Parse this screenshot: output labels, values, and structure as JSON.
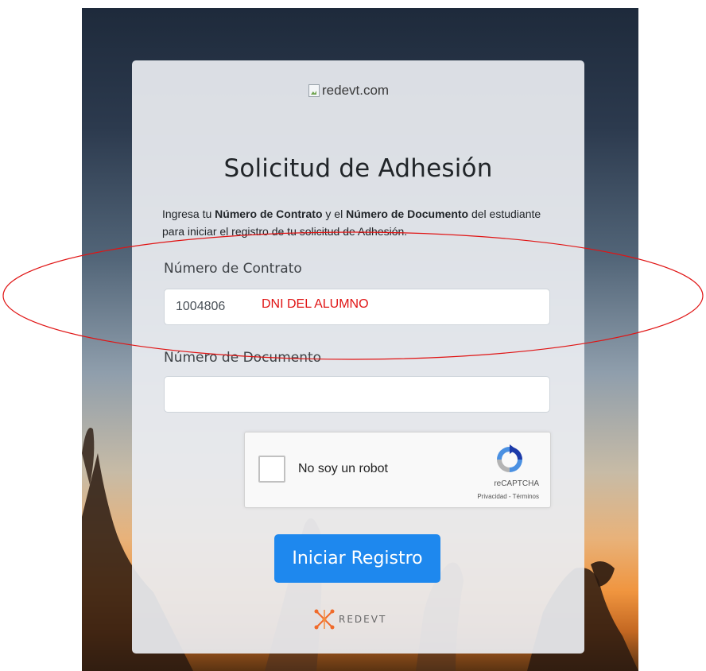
{
  "header": {
    "logo_alt": "redevt.com"
  },
  "form": {
    "title": "Solicitud de Adhesión",
    "description": {
      "part1": "Ingresa tu ",
      "bold1": "Número de Contrato",
      "part2": " y el ",
      "bold2": "Número de Documento",
      "part3": " del estudiante para iniciar el registro de tu solicitud de Adhesión."
    },
    "contract_label": "Número de Contrato",
    "contract_value": "1004806",
    "document_label": "Número de Documento",
    "document_value": "",
    "submit_label": "Iniciar Registro"
  },
  "captcha": {
    "label": "No soy un robot",
    "brand": "reCAPTCHA",
    "links": "Privacidad - Términos"
  },
  "annotation": {
    "text": "DNI DEL ALUMNO",
    "color": "#e01414"
  },
  "footer": {
    "brand": "REDEVT"
  },
  "colors": {
    "primary_button": "#1e88ee",
    "card_background": "#e9ecf0"
  }
}
